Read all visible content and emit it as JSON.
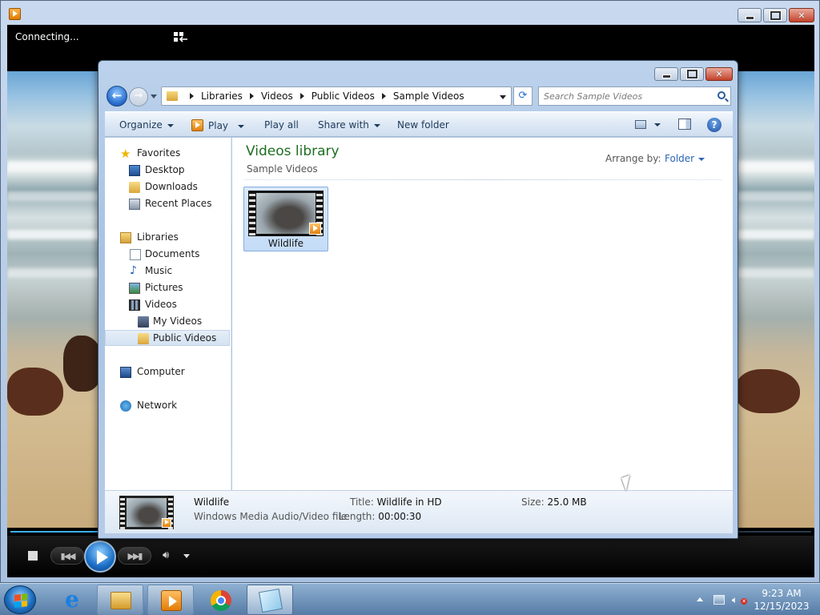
{
  "wmp": {
    "status": "Connecting...",
    "icons": [
      "wmp-app-icon",
      "switch-to-library-icon",
      "stop-icon",
      "previous-icon",
      "play-icon",
      "next-icon",
      "volume-icon"
    ],
    "seek_progress": 0.11
  },
  "explorer": {
    "address": {
      "crumbs": [
        "Libraries",
        "Videos",
        "Public Videos",
        "Sample Videos"
      ]
    },
    "search": {
      "placeholder": "Search Sample Videos"
    },
    "toolbar": {
      "organize": "Organize",
      "play": "Play",
      "play_all": "Play all",
      "share_with": "Share with",
      "new_folder": "New folder"
    },
    "nav": {
      "favorites": "Favorites",
      "desktop": "Desktop",
      "downloads": "Downloads",
      "recent_places": "Recent Places",
      "libraries": "Libraries",
      "documents": "Documents",
      "music": "Music",
      "pictures": "Pictures",
      "videos": "Videos",
      "my_videos": "My Videos",
      "public_videos": "Public Videos",
      "computer": "Computer",
      "network": "Network"
    },
    "content": {
      "title": "Videos library",
      "subtitle": "Sample Videos",
      "arrange_label": "Arrange by:",
      "arrange_value": "Folder",
      "files": [
        {
          "name": "Wildlife"
        }
      ]
    },
    "details": {
      "name": "Wildlife",
      "type": "Windows Media Audio/Video file",
      "title_label": "Title:",
      "title_value": "Wildlife in HD",
      "length_label": "Length:",
      "length_value": "00:00:30",
      "size_label": "Size:",
      "size_value": "25.0 MB"
    }
  },
  "taskbar": {
    "apps": [
      "internet-explorer-icon",
      "windows-explorer-icon",
      "windows-media-player-icon",
      "chrome-icon",
      "notepad-icon"
    ],
    "time": "9:23 AM",
    "date": "12/15/2023"
  }
}
